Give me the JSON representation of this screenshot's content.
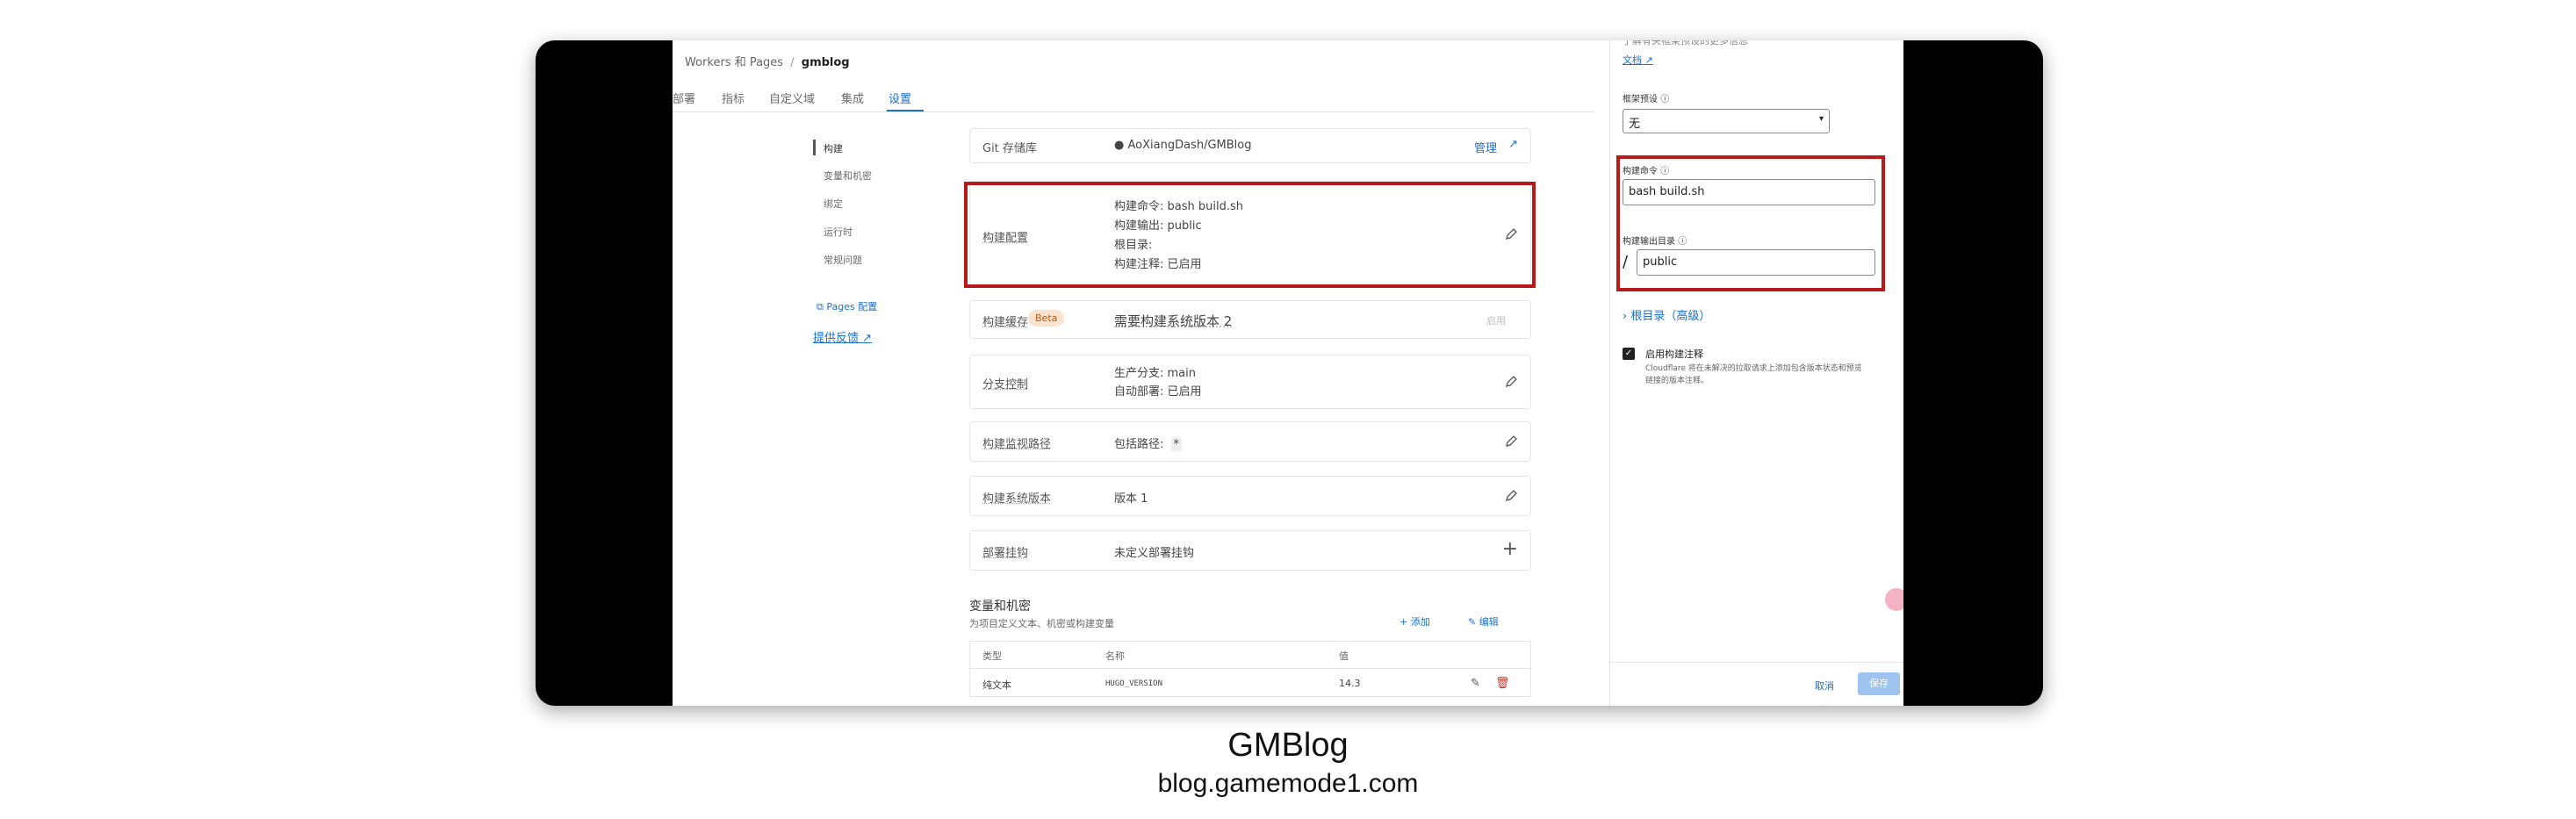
{
  "breadcrumb": {
    "root": "Workers 和 Pages",
    "sep": "/",
    "project": "gmblog"
  },
  "tabs": [
    {
      "label": "部署"
    },
    {
      "label": "指标"
    },
    {
      "label": "自定义域"
    },
    {
      "label": "集成"
    },
    {
      "label": "设置",
      "active": true
    }
  ],
  "side_nav": {
    "items": [
      {
        "label": "构建"
      },
      {
        "label": "变量和机密"
      },
      {
        "label": "绑定"
      },
      {
        "label": "运行时"
      },
      {
        "label": "常规问题"
      }
    ],
    "pages_config": "Pages 配置",
    "feedback": "提供反馈"
  },
  "cards": {
    "git": {
      "label": "Git 存储库",
      "value": "AoXiangDash/GMBlog",
      "action": "管理"
    },
    "build_config": {
      "label": "构建配置",
      "lines": [
        "构建命令: bash build.sh",
        "构建输出: public",
        "根目录:",
        "构建注释: 已启用"
      ]
    },
    "build_cache": {
      "label": "构建缓存",
      "badge": "Beta",
      "value": "需要构建系统版本 2",
      "action": "启用"
    },
    "branch": {
      "label": "分支控制",
      "lines": [
        "生产分支: main",
        "自动部署: 已启用"
      ]
    },
    "watch_paths": {
      "label": "构建监视路径",
      "value": "包括路径:",
      "value_extra": "*"
    },
    "system_version": {
      "label": "构建系统版本",
      "value": "版本 1"
    },
    "deploy_hooks": {
      "label": "部署挂钩",
      "value": "未定义部署挂钩"
    }
  },
  "variables": {
    "title": "变量和机密",
    "subtitle": "为项目定义文本、机密或构建变量",
    "add_label": "添加",
    "edit_label": "编辑",
    "columns": [
      "类型",
      "名称",
      "值"
    ],
    "rows": [
      {
        "type": "纯文本",
        "name": "HUGO_VERSION",
        "value": "14.3"
      }
    ]
  },
  "panel": {
    "top_clip": "了解有关框架预设的更多信息",
    "docs_link": "文档",
    "preset_label": "框架预设",
    "preset_value": "无",
    "build_cmd_label": "构建命令",
    "build_cmd_value": "bash build.sh",
    "output_dir_label": "构建输出目录",
    "output_prefix": "/",
    "output_dir_value": "public",
    "root_dir_label": "根目录（高级）",
    "comments_label": "启用构建注释",
    "comments_desc_1": "Cloudflare 将在未解决的拉取请求上添加包含版本状态和预览",
    "comments_desc_2": "链接的版本注释。",
    "cancel": "取消",
    "save": "保存"
  },
  "caption": {
    "title": "GMBlog",
    "url": "blog.gamemode1.com"
  },
  "colors": {
    "accent": "#1a6fd1",
    "highlight": "#b8191b",
    "frame": "#000000"
  }
}
